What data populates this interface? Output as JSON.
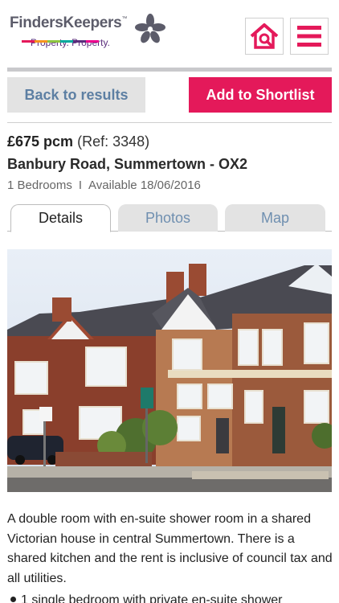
{
  "header": {
    "logo_name": "FindersKeepers",
    "logo_tm": "™",
    "logo_tagline": "Property. Property.",
    "logo_bar_colors": [
      "#e4195a",
      "#f7941d",
      "#8dc63f",
      "#00a99d",
      "#5a2d7c",
      "#ec008c"
    ],
    "home_search_icon": "home-search-icon",
    "menu_icon": "hamburger-menu-icon",
    "accent_color": "#e4195a"
  },
  "actions": {
    "back_label": "Back to results",
    "shortlist_label": "Add to Shortlist"
  },
  "listing": {
    "price": "£675 pcm",
    "ref": "(Ref: 3348)",
    "address": "Banbury Road, Summertown - OX2",
    "bedrooms": "1 Bedrooms",
    "separator": "I",
    "available": "Available 18/06/2016"
  },
  "tabs": [
    {
      "label": "Details",
      "active": true
    },
    {
      "label": "Photos",
      "active": false
    },
    {
      "label": "Map",
      "active": false
    }
  ],
  "description": "A double room with en-suite shower room in a shared Victorian house in central Summertown. There is a shared kitchen and the rent is inclusive of council tax and all utilities.",
  "features": [
    "1 single bedroom with private en-suite shower"
  ]
}
